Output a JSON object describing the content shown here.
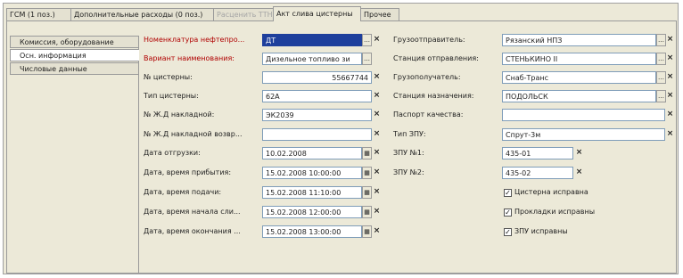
{
  "tabs": [
    {
      "label": "ГСМ (1 поз.)"
    },
    {
      "label": "Дополнительные расходы (0 поз.)"
    },
    {
      "label": "Расценить ТТН"
    },
    {
      "label": "Акт слива цистерны"
    },
    {
      "label": "Прочее"
    }
  ],
  "side_tabs": [
    {
      "label": "Комиссия, оборудование"
    },
    {
      "label": "Осн. информация"
    },
    {
      "label": "Числовые данные"
    }
  ],
  "left_fields": {
    "nomenclature": {
      "label": "Номенклатура нефтепро...",
      "value": "ДТ"
    },
    "variant": {
      "label": "Вариант наименования:",
      "value": "Дизельное топливо зи"
    },
    "tank_no": {
      "label": "№ цистерны:",
      "value": "55667744"
    },
    "tank_type": {
      "label": "Тип цистерны:",
      "value": "62А"
    },
    "waybill": {
      "label": "№ Ж.Д накладной:",
      "value": "ЭК2039"
    },
    "waybill_return": {
      "label": "№ Ж.Д накладной возвр...",
      "value": ""
    },
    "ship_date": {
      "label": "Дата отгрузки:",
      "value": "10.02.2008"
    },
    "arrival": {
      "label": "Дата, время прибытия:",
      "value": "15.02.2008 10:00:00"
    },
    "delivery": {
      "label": "Дата, время подачи:",
      "value": "15.02.2008 11:10:00"
    },
    "drain_start": {
      "label": "Дата, время начала сли...",
      "value": "15.02.2008 12:00:00"
    },
    "drain_end": {
      "label": "Дата, время окончания ...",
      "value": "15.02.2008 13:00:00"
    }
  },
  "right_fields": {
    "shipper": {
      "label": "Грузоотправитель:",
      "value": "Рязанский НПЗ"
    },
    "dep_station": {
      "label": "Станция отправления:",
      "value": "СТЕНЬКИНО II"
    },
    "consignee": {
      "label": "Грузополучатель:",
      "value": "Снаб-Транс"
    },
    "dest_station": {
      "label": "Станция назначения:",
      "value": "ПОДОЛЬСК"
    },
    "quality_passport": {
      "label": "Паспорт качества:",
      "value": ""
    },
    "zpu_type": {
      "label": "Тип ЗПУ:",
      "value": "Спрут-3м"
    },
    "zpu1": {
      "label": "ЗПУ №1:",
      "value": "435-01"
    },
    "zpu2": {
      "label": "ЗПУ №2:",
      "value": "435-02"
    }
  },
  "checkboxes": [
    {
      "label": "Цистерна исправна",
      "checked": true
    },
    {
      "label": "Прокладки исправны",
      "checked": true
    },
    {
      "label": "ЗПУ исправны",
      "checked": true
    }
  ],
  "icons": {
    "select": "…",
    "clear": "×",
    "calendar": "▦",
    "check": "✓"
  },
  "colors": {
    "required_label": "#b00000",
    "selection": "#1e3f9c",
    "panel_bg": "#ece9d8"
  }
}
